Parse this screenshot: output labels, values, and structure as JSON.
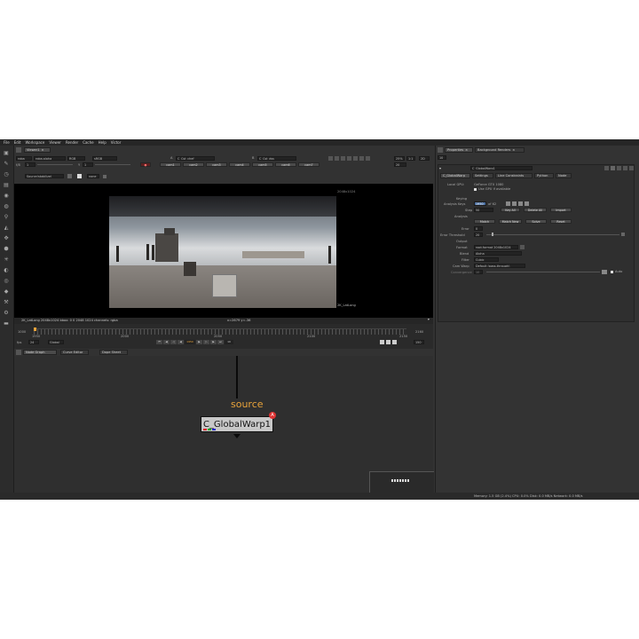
{
  "menu": [
    "File",
    "Edit",
    "Workspace",
    "Viewer",
    "Render",
    "Cache",
    "Help",
    "Victor"
  ],
  "viewer_tab": "Viewer1",
  "viewer_controls": {
    "channels": "rgba",
    "alpha": "rgba.alpha",
    "color": "RGB",
    "input": "sRGB",
    "a_input": "A",
    "node_a": "C_Cst_chef",
    "b_input": "B",
    "node_b": "C_Cst_dss",
    "zoom": "25%",
    "ratio": "1:1",
    "mode": "2D",
    "fstop_label": "f/8",
    "fstop_value": "1",
    "frame_label": "Y",
    "frame_value": "1",
    "camera_buttons": [
      "cam1",
      "cam2",
      "cam3",
      "cam4",
      "cam5",
      "cam6",
      "cam7"
    ],
    "second_row_dropdown": "Source(stabilize)",
    "second_row_mode": "none",
    "proxy_value": "20"
  },
  "viewer": {
    "format_label": "2048x1024",
    "node_label": "2K_LatLong",
    "status": "2K_LatLong 2048x1024  bbox: 0 0 2048 1024 channels: rgba",
    "coords": "x=2679 y=-36"
  },
  "timeline": {
    "start": "1000",
    "current_marker": "1950",
    "ticks": [
      "1950",
      "2000",
      "2050",
      "2100",
      "2150"
    ],
    "end": "2160",
    "fps_label": "fps",
    "fps_value": "24",
    "playback_mode": "Global",
    "frame_field": "1950",
    "step": "10",
    "range_end": "150"
  },
  "node_tabs": [
    "Node Graph",
    "Curve Editor",
    "Dope Sheet"
  ],
  "node_graph": {
    "label": "source",
    "node_name": "C_GlobalWarp1",
    "badge": "A"
  },
  "properties": {
    "tabs": [
      "Properties",
      "Background Renders"
    ],
    "value_field": "10",
    "node_title": "C_GlobalWarp1",
    "section_tabs": [
      "C_GlobalWarp",
      "Settings",
      "Line Constraints",
      "Python",
      "Node"
    ],
    "local_gpu_label": "Local GPU:",
    "local_gpu_value": "GeForce GTX 1080",
    "use_gpu": "Use GPU if available",
    "keying_label": "Keying",
    "analysis_keys_label": "Analysis Keys",
    "analysis_keys_value": "1950",
    "analysis_keys_of": "of 62",
    "step_label": "Step",
    "step_value": "50",
    "key_all": "Key All",
    "delete_all": "Delete All",
    "import": "Import",
    "analysis_label": "Analysis",
    "match": "Match",
    "match_new": "Match New",
    "solve": "Solve",
    "reset": "Reset",
    "error_label": "Error",
    "error_value": "0",
    "error_threshold_label": "Error Threshold",
    "error_threshold_value": "20",
    "output_label": "Output",
    "format_label": "Format",
    "format_value": "root.format 2048x1024",
    "blend_label": "Blend",
    "blend_value": "Alpha",
    "filter_label": "Filter",
    "filter_value": "Cubic",
    "cam_warp_label": "Cam Warp",
    "cam_warp_value": "Default (pass-through)",
    "convergence_label": "Convergence",
    "convergence_value": "10",
    "auto": "Auto"
  },
  "status_bar": "Memory: 1.5 GB (2.4%)  CPU: 0.0%  Disk: 0.0 MB/s  Network: 0.0 MB/s"
}
